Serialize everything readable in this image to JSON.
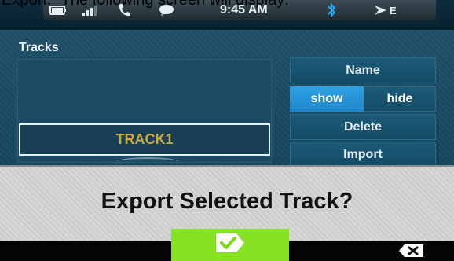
{
  "caption": "Export.\" The following screen will display:",
  "status": {
    "time": "9:45 AM"
  },
  "tracks": {
    "title": "Tracks",
    "items": [
      {
        "label": "TRACK1"
      }
    ]
  },
  "actions": {
    "name_label": "Name",
    "show_label": "show",
    "hide_label": "hide",
    "delete_label": "Delete",
    "import_label": "Import",
    "selected_toggle": "show"
  },
  "dialog": {
    "question": "Export Selected Track?"
  },
  "icons": {
    "battery": "battery-icon",
    "signal": "signal-icon",
    "phone": "phone-icon",
    "message": "message-icon",
    "bluetooth": "bluetooth-icon",
    "navigation": "navigation-icon",
    "confirm": "checkmark-icon",
    "cancel": "close-icon"
  },
  "colors": {
    "accent_blue": "#2ea1e4",
    "confirm_green": "#86e122",
    "track_text": "#c9a94a"
  }
}
